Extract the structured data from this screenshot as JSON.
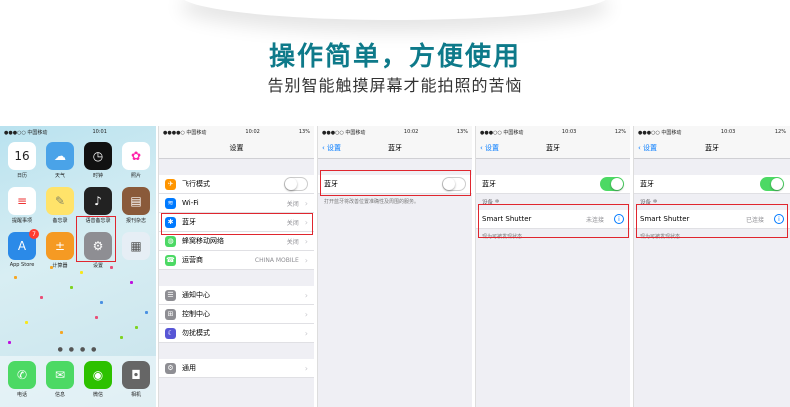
{
  "headline": "操作简单，方便使用",
  "subline": "告别智能触摸屏幕才能拍照的苦恼",
  "home": {
    "status_carrier": "●●●○○ 中国移动",
    "status_time": "10:01",
    "status_battery": "",
    "apps": [
      {
        "name": "日历",
        "icon": "calendar-icon",
        "glyph": "16",
        "color": "#ffffff",
        "fg": "#222"
      },
      {
        "name": "天气",
        "icon": "weather-icon",
        "glyph": "☁",
        "color": "#4aa3e8",
        "fg": "#fff"
      },
      {
        "name": "时钟",
        "icon": "clock-icon",
        "glyph": "◷",
        "color": "#111111",
        "fg": "#fff"
      },
      {
        "name": "照片",
        "icon": "photos-icon",
        "glyph": "✿",
        "color": "#ffffff",
        "fg": "#f2a"
      },
      {
        "name": "提醒事项",
        "icon": "reminders-icon",
        "glyph": "≡",
        "color": "#ffffff",
        "fg": "#e33"
      },
      {
        "name": "备忘录",
        "icon": "notes-icon",
        "glyph": "✎",
        "color": "#ffe36a",
        "fg": "#886"
      },
      {
        "name": "语音备忘录",
        "icon": "voice-memo-icon",
        "glyph": "♪",
        "color": "#222222",
        "fg": "#fff"
      },
      {
        "name": "报刊杂志",
        "icon": "newsstand-icon",
        "glyph": "▤",
        "color": "#8a5a3a",
        "fg": "#fff"
      },
      {
        "name": "App Store",
        "icon": "app-store-icon",
        "glyph": "A",
        "color": "#2b8ae8",
        "fg": "#fff",
        "badge": "7"
      },
      {
        "name": "计算器",
        "icon": "calculator-icon",
        "glyph": "±",
        "color": "#f59a23",
        "fg": "#fff"
      },
      {
        "name": "设置",
        "icon": "settings-icon",
        "glyph": "⚙",
        "color": "#8e8e93",
        "fg": "#fff"
      },
      {
        "name": "",
        "icon": "folder-icon",
        "glyph": "▦",
        "color": "#e6eef5",
        "fg": "#555"
      }
    ],
    "dock": [
      {
        "name": "电话",
        "icon": "phone-icon",
        "glyph": "✆",
        "color": "#4cd964"
      },
      {
        "name": "信息",
        "icon": "messages-icon",
        "glyph": "✉",
        "color": "#4cd964"
      },
      {
        "name": "微信",
        "icon": "wechat-icon",
        "glyph": "◉",
        "color": "#2dc100"
      },
      {
        "name": "相机",
        "icon": "camera-icon",
        "glyph": "◘",
        "color": "#666666"
      }
    ],
    "page_dots": "● ● ● ●"
  },
  "settings": {
    "status_carrier": "●●●●○ 中国移动",
    "status_time": "10:02",
    "status_battery": "13%",
    "title": "设置",
    "group1": [
      {
        "label": "飞行模式",
        "icon": "airplane-icon",
        "glyph": "✈",
        "color": "#ff9500",
        "toggle": true
      },
      {
        "label": "Wi-Fi",
        "icon": "wifi-icon",
        "glyph": "≋",
        "color": "#007aff",
        "value": "关闭"
      },
      {
        "label": "蓝牙",
        "icon": "bluetooth-icon",
        "glyph": "✱",
        "color": "#007aff",
        "value": "关闭"
      },
      {
        "label": "蜂窝移动网络",
        "icon": "cellular-icon",
        "glyph": "◍",
        "color": "#4cd964",
        "value": "关闭"
      },
      {
        "label": "运营商",
        "icon": "carrier-icon",
        "glyph": "☎",
        "color": "#4cd964",
        "value": "CHINA MOBILE"
      }
    ],
    "group2": [
      {
        "label": "通知中心",
        "icon": "notification-center-icon",
        "glyph": "☰",
        "color": "#8e8e93"
      },
      {
        "label": "控制中心",
        "icon": "control-center-icon",
        "glyph": "⊞",
        "color": "#8e8e93"
      },
      {
        "label": "勿扰模式",
        "icon": "do-not-disturb-icon",
        "glyph": "☾",
        "color": "#5856d6"
      }
    ],
    "group3": [
      {
        "label": "通用",
        "icon": "general-icon",
        "glyph": "⚙",
        "color": "#8e8e93"
      }
    ]
  },
  "bt_off": {
    "status_carrier": "●●●○○ 中国移动",
    "status_time": "10:02",
    "status_battery": "13%",
    "back": "设置",
    "title": "蓝牙",
    "row_label": "蓝牙",
    "note": "打开蓝牙将改善位置准确性及周围的服务。"
  },
  "bt_on": {
    "status_carrier": "●●●○○ 中国移动",
    "status_time": "10:03",
    "status_battery": "12%",
    "back": "设置",
    "title": "蓝牙",
    "row_label": "蓝牙",
    "devices_header": "设备",
    "device_name": "Smart Shutter",
    "device_status": "未连接",
    "discoverable": "现为可被发现状态"
  },
  "bt_connected": {
    "status_carrier": "●●●○○ 中国移动",
    "status_time": "10:03",
    "status_battery": "12%",
    "back": "设置",
    "title": "蓝牙",
    "row_label": "蓝牙",
    "devices_header": "设备",
    "device_name": "Smart Shutter",
    "device_status": "已连接",
    "discoverable": "现为可被发现状态"
  }
}
